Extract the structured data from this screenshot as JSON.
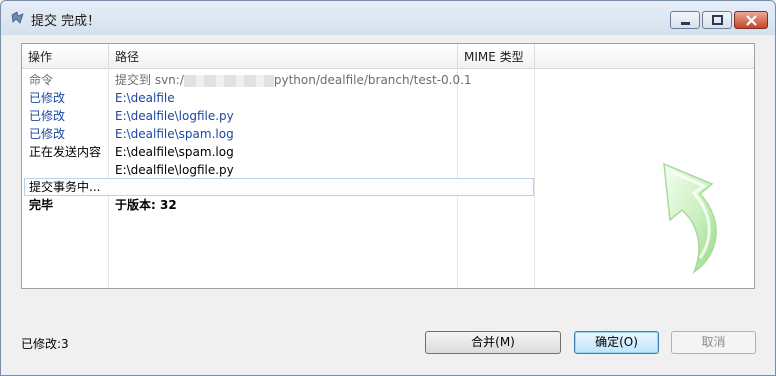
{
  "window": {
    "title": "提交 完成！"
  },
  "columns": [
    "操作",
    "路径",
    "MIME 类型"
  ],
  "rows": [
    {
      "action": "命令",
      "path_prefix": "提交到 svn:/",
      "path": "python/dealfile/branch/test-0.0.1"
    },
    {
      "action": "已修改",
      "path": "E:\\dealfile"
    },
    {
      "action": "已修改",
      "path": "E:\\dealfile\\logfile.py"
    },
    {
      "action": "已修改",
      "path": "E:\\dealfile\\spam.log"
    },
    {
      "action": "正在发送内容",
      "path": "E:\\dealfile\\spam.log"
    },
    {
      "action": "",
      "path": "E:\\dealfile\\logfile.py"
    },
    {
      "action": "提交事务中...",
      "path": ""
    },
    {
      "action": "完毕",
      "path": "于版本: 32"
    }
  ],
  "status": "已修改:3",
  "buttons": {
    "merge": "合并(M)",
    "ok": "确定(O)",
    "cancel": "取消"
  },
  "colors": {
    "modified": "#1c48a0",
    "command": "#6d6d6d",
    "arrow": "#7ad36e"
  },
  "icons": [
    "app-icon",
    "minimize-icon",
    "maximize-icon",
    "close-icon",
    "commit-arrow-icon"
  ]
}
